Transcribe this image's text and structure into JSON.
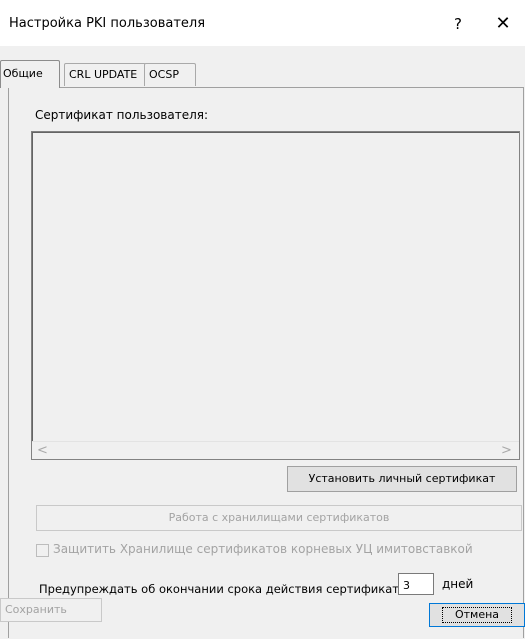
{
  "window": {
    "title": "Настройка PKI пользователя",
    "help_label": "?",
    "close_label": "✕"
  },
  "tabs": [
    {
      "label": "Общие",
      "active": true
    },
    {
      "label": "CRL UPDATE",
      "active": false
    },
    {
      "label": "OCSP",
      "active": false
    }
  ],
  "general": {
    "cert_label": "Сертификат пользователя:",
    "scroll_left": "<",
    "scroll_right": ">",
    "install_button": "Установить личный сертификат",
    "store_button": "Работа с хранилищами сертификатов",
    "protect_checkbox": {
      "label": "Защитить Хранилище сертификатов корневых УЦ имитовставкой",
      "checked": false,
      "enabled": false
    },
    "warn_label": "Предупреждать об окончании срока действия сертификата",
    "warn_days_value": "3",
    "days_unit": "дней"
  },
  "footer": {
    "save_button": "Сохранить",
    "cancel_button": "Отмена"
  },
  "colors": {
    "background": "#f0f0f0",
    "titlebar": "#ffffff",
    "focus_border": "#0078d7",
    "disabled_text": "#a3a3a3"
  }
}
